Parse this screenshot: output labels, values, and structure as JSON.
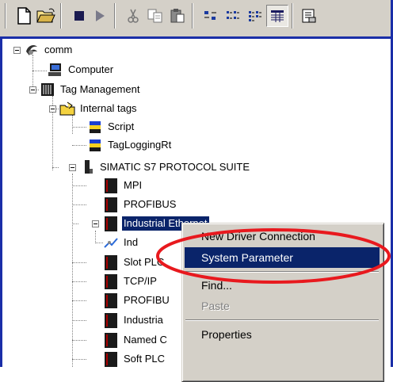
{
  "toolbar": {
    "buttons": [
      "new-icon",
      "open-icon",
      "stop-icon",
      "play-icon",
      "cut-icon",
      "copy-icon",
      "paste-icon",
      "large-icons-icon",
      "small-icons-icon",
      "list-view-icon",
      "details-view-icon",
      "properties-icon"
    ]
  },
  "tree": {
    "root": "comm",
    "computer": "Computer",
    "tag_management": "Tag Management",
    "internal_tags": "Internal tags",
    "script": "Script",
    "tag_logging": "TagLoggingRt",
    "simatic": "SIMATIC S7 PROTOCOL SUITE",
    "mpi": "MPI",
    "profibus": "PROFIBUS",
    "industrial_ethernet": "Industrial Ethernet",
    "industrial_child": "Ind",
    "slot_plc": "Slot PLC",
    "tcpip": "TCP/IP",
    "profibus2": "PROFIBU",
    "industrial2": "Industria",
    "named": "Named C",
    "soft_plc": "Soft PLC"
  },
  "menu": {
    "new_driver": "New Driver Connection",
    "system_parameter": "System Parameter",
    "find": "Find...",
    "paste": "Paste",
    "properties": "Properties"
  },
  "colors": {
    "highlight": "#0a246a",
    "annotation": "#e8191e",
    "chrome": "#d4d0c8"
  }
}
